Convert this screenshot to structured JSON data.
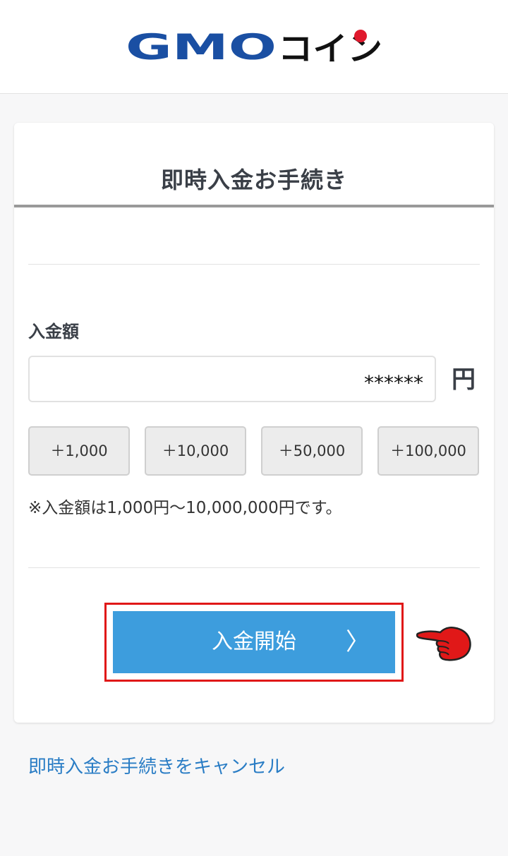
{
  "header": {
    "logo_latin": "GMO",
    "logo_kana": "コイン"
  },
  "form": {
    "title": "即時入金お手続き",
    "amount_label": "入金額",
    "amount_value": "******",
    "amount_unit": "円",
    "quick_buttons": [
      "＋1,000",
      "＋10,000",
      "＋50,000",
      "＋100,000"
    ],
    "note": "※入金額は1,000円〜10,000,000円です。",
    "start_button_label": "入金開始",
    "start_button_chevron": "〉"
  },
  "cancel_link": "即時入金お手続きをキャンセル",
  "colors": {
    "logo_blue": "#1a4fa3",
    "logo_red": "#e0192d",
    "primary_button": "#3d9ddd",
    "highlight_red": "#e01818",
    "link": "#2a7dc5"
  },
  "icons": [
    "pointing-hand-icon",
    "chevron-right-icon"
  ]
}
